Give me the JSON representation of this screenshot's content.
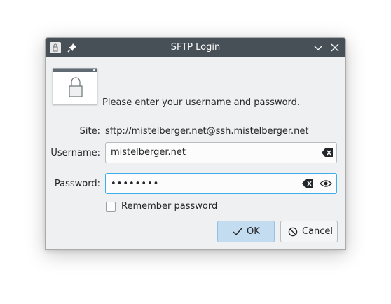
{
  "window": {
    "title": "SFTP Login"
  },
  "prompt": "Please enter your username and password.",
  "site": {
    "label": "Site:",
    "value": "sftp://mistelberger.net@ssh.mistelberger.net"
  },
  "username": {
    "label": "Username:",
    "value": "mistelberger.net"
  },
  "password": {
    "label": "Password:",
    "masked_value": "••••••••"
  },
  "remember": {
    "label": "Remember password",
    "checked": false
  },
  "buttons": {
    "ok": "OK",
    "cancel": "Cancel"
  },
  "colors": {
    "titlebar": "#475057",
    "accent": "#3daee9",
    "dialog_bg": "#eff0f1",
    "ok_button": "#c4dcef"
  },
  "icons": [
    "app-icon",
    "pin-icon",
    "minimize-chevron-icon",
    "close-icon",
    "lock-icon",
    "clear-text-icon",
    "show-password-eye-icon",
    "checkmark-icon",
    "cancel-circle-icon"
  ]
}
